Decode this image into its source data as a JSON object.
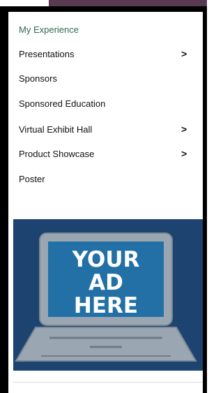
{
  "menu": {
    "items": [
      {
        "label": "My Experience",
        "chevron": false,
        "active": true
      },
      {
        "label": "Presentations",
        "chevron": true
      },
      {
        "label": "Sponsors",
        "chevron": false
      },
      {
        "label": "Sponsored Education",
        "chevron": false
      },
      {
        "label": "Virtual Exhibit Hall",
        "chevron": true
      },
      {
        "label": "Product Showcase",
        "chevron": true
      },
      {
        "label": "Poster",
        "chevron": false
      }
    ],
    "chevron_glyph": ">"
  },
  "ad": {
    "line1": "YOUR",
    "line2": "AD",
    "line3": "HERE",
    "background_color": "#1d4470",
    "screen_color": "#2270a6",
    "laptop_color": "#9aa6b2"
  },
  "colors": {
    "accent_active": "#2f6b4f",
    "top_bar": "#5a3a52",
    "frame": "#000000"
  }
}
